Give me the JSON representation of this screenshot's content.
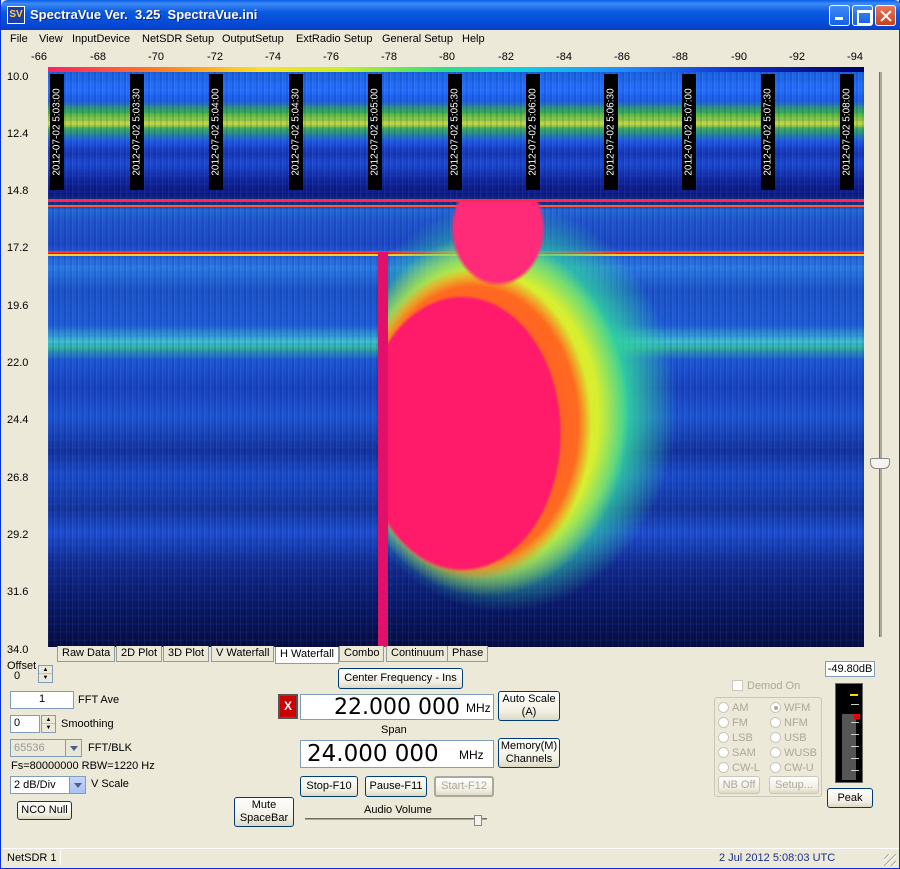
{
  "window": {
    "app_icon": "SV",
    "title": "SpectraVue Ver.  3.25  SpectraVue.ini"
  },
  "menu": [
    "File",
    "View",
    "InputDevice",
    "NetSDR Setup",
    "OutputSetup",
    "ExtRadio Setup",
    "General Setup",
    "Help"
  ],
  "waterfall": {
    "color_scale_labels": [
      "-66",
      "-68",
      "-70",
      "-72",
      "-74",
      "-76",
      "-78",
      "-80",
      "-82",
      "-84",
      "-86",
      "-88",
      "-90",
      "-92",
      "-94"
    ],
    "time_axis_labels": [
      "10.0",
      "12.4",
      "14.8",
      "17.2",
      "19.6",
      "22.0",
      "24.4",
      "26.8",
      "29.2",
      "31.6",
      "34.0"
    ],
    "timestamps": [
      "2012-07-02 5:03:00",
      "2012-07-02 5:03:30",
      "2012-07-02 5:04:00",
      "2012-07-02 5:04:30",
      "2012-07-02 5:05:00",
      "2012-07-02 5:05:30",
      "2012-07-02 5:06:00",
      "2012-07-02 5:06:30",
      "2012-07-02 5:07:00",
      "2012-07-02 5:07:30",
      "2012-07-02 5:08:00"
    ]
  },
  "tabs": [
    "Raw Data",
    "2D Plot",
    "3D Plot",
    "V Waterfall",
    "H Waterfall",
    "Combo",
    "Continuum",
    "Phase"
  ],
  "controls": {
    "offset_label": "Offset",
    "offset_value": "0",
    "fft_ave_value": "1",
    "fft_ave_label": "FFT Ave",
    "smoothing_value": "0",
    "smoothing_label": "Smoothing",
    "fft_blk_value": "65536",
    "fft_blk_label": "FFT/BLK",
    "fs_rbw": "Fs=80000000 RBW=1220 Hz",
    "vscale_value": "2 dB/Div",
    "vscale_label": "V Scale",
    "nco_null": "NCO Null",
    "mute": "Mute\nSpaceBar"
  },
  "center": {
    "center_freq_button": "Center Frequency - Ins",
    "indicator": "X",
    "frequency": "22.000 000",
    "freq_unit": "MHz",
    "auto_scale": "Auto Scale\n(A)",
    "span_label": "Span",
    "span": "24.000 000",
    "span_unit": "MHz",
    "memory": "Memory(M)\nChannels",
    "stop": "Stop-F10",
    "pause": "Pause-F11",
    "start": "Start-F12",
    "audio_volume_label": "Audio Volume",
    "audio_volume": 0.95
  },
  "demod": {
    "label": "Demod On",
    "modes_left": [
      "AM",
      "FM",
      "LSB",
      "SAM",
      "CW-L"
    ],
    "modes_right": [
      "WFM",
      "NFM",
      "USB",
      "WUSB",
      "CW-U"
    ],
    "selected": "WFM",
    "nb_off": "NB Off",
    "setup": "Setup..."
  },
  "meter": {
    "value_text": "-49.80dB",
    "peak_button": "Peak"
  },
  "status": {
    "device": "NetSDR 1",
    "datetime": "2 Jul 2012  5:08:03 UTC"
  }
}
